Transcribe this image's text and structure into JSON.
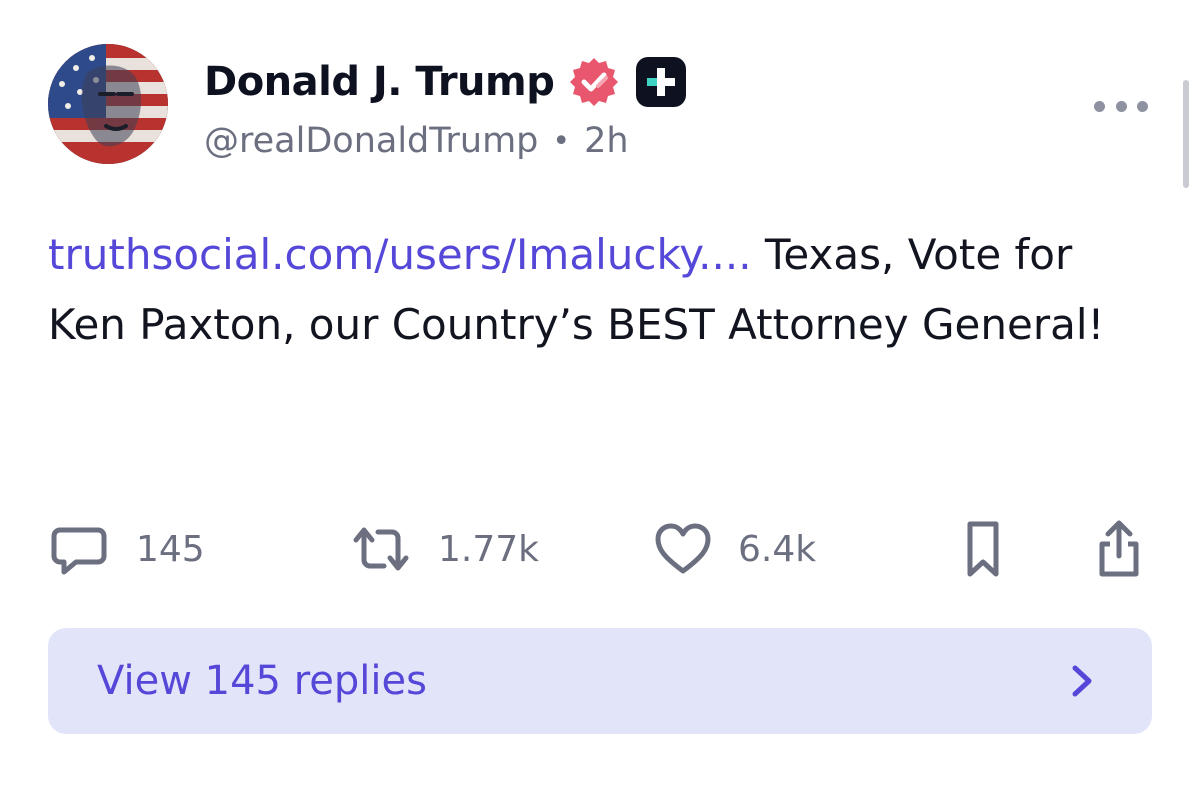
{
  "post": {
    "display_name": "Donald J. Trump",
    "handle": "@realDonaldTrump",
    "separator": "•",
    "time": "2h",
    "link_text": "truthsocial.com/users/Imalucky....",
    "body_text": " Texas, Vote for Ken Paxton, our Country’s BEST Attorney General!"
  },
  "badges": {
    "verified_icon": "verified-check-icon",
    "plus_icon": "plus-icon"
  },
  "actions": {
    "replies_count": "145",
    "retruths_count": "1.77k",
    "likes_count": "6.4k"
  },
  "replies_button": {
    "label": "View 145 replies"
  },
  "colors": {
    "link": "#5547d8",
    "verified": "#e8576d",
    "muted": "#6b6f80",
    "replies_bg": "#e2e5fa"
  }
}
